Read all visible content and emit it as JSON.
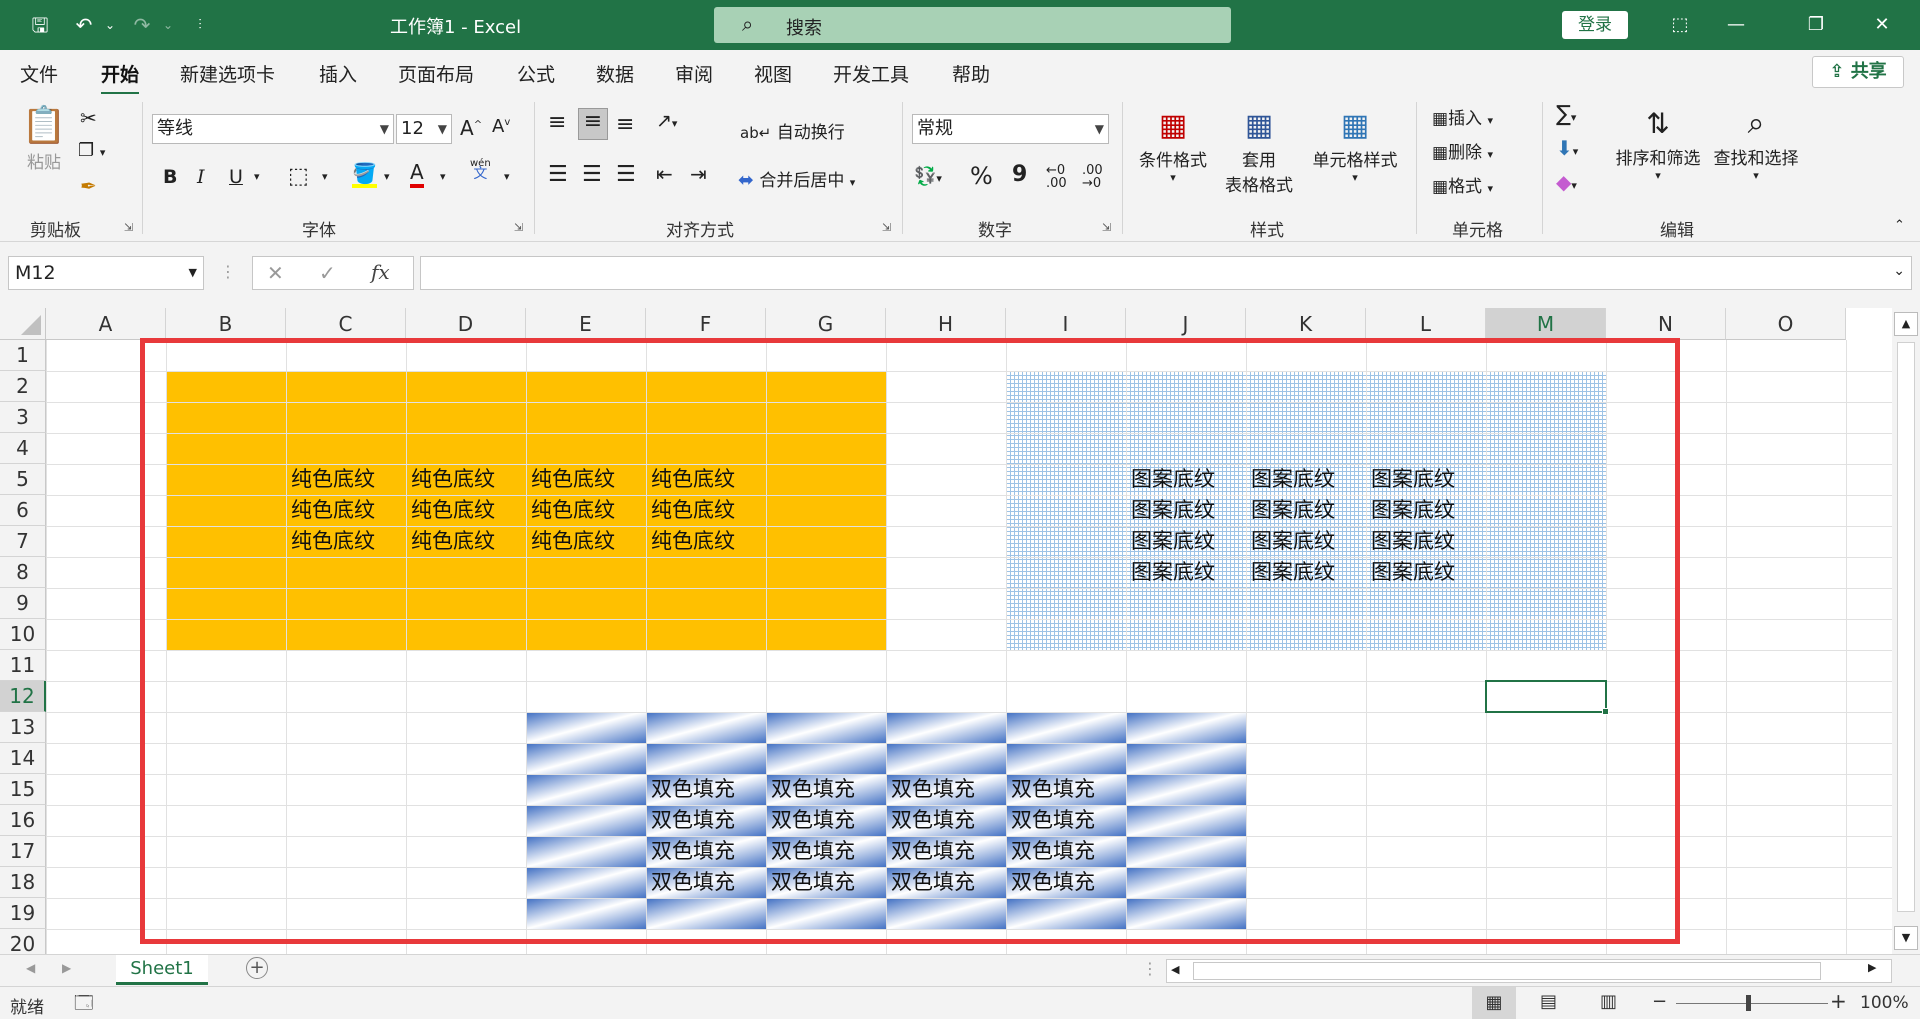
{
  "titlebar": {
    "save_icon": "save-icon",
    "undo_icon": "undo-icon",
    "redo_icon": "redo-icon",
    "title": "工作簿1  -  Excel",
    "search_placeholder": "搜索",
    "login": "登录"
  },
  "tabs": [
    "文件",
    "开始",
    "新建选项卡",
    "插入",
    "页面布局",
    "公式",
    "数据",
    "审阅",
    "视图",
    "开发工具",
    "帮助"
  ],
  "active_tab": "开始",
  "share": "共享",
  "ribbon": {
    "clipboard": {
      "paste": "粘贴",
      "label": "剪贴板"
    },
    "font": {
      "name": "等线",
      "size": "12",
      "bold": "B",
      "italic": "I",
      "underline": "U",
      "wen": "wén",
      "wen2": "文",
      "label": "字体"
    },
    "align": {
      "wrap": "自动换行",
      "merge": "合并后居中",
      "label": "对齐方式"
    },
    "number": {
      "format": "常规",
      "percent": "%",
      "comma": "9",
      "label": "数字"
    },
    "styles": {
      "cond": "条件格式",
      "table_1": "套用",
      "table_2": "表格格式",
      "cell": "单元格样式",
      "label": "样式"
    },
    "cells": {
      "insert": "插入",
      "delete": "删除",
      "format": "格式",
      "label": "单元格"
    },
    "edit": {
      "sort": "排序和筛选",
      "find": "查找和选择",
      "label": "编辑"
    }
  },
  "formula_bar": {
    "name_box": "M12",
    "fx": "fx",
    "value": ""
  },
  "columns": [
    "A",
    "B",
    "C",
    "D",
    "E",
    "F",
    "G",
    "H",
    "I",
    "J",
    "K",
    "L",
    "M",
    "N",
    "O"
  ],
  "rows": [
    "1",
    "2",
    "3",
    "4",
    "5",
    "6",
    "7",
    "8",
    "9",
    "10",
    "11",
    "12",
    "13",
    "14",
    "15",
    "16",
    "17",
    "18",
    "19",
    "20"
  ],
  "selected_cell": "M12",
  "blocks": {
    "solid": {
      "text": "纯色底纹",
      "color": "#ffc000"
    },
    "pattern": {
      "text": "图案底纹",
      "color": "#9dc3e6"
    },
    "gradient": {
      "text": "双色填充",
      "color": "#4472c4"
    }
  },
  "highlight_color": "#e8393b",
  "sheet_tab": "Sheet1",
  "status": {
    "ready": "就绪",
    "zoom": "100%"
  }
}
